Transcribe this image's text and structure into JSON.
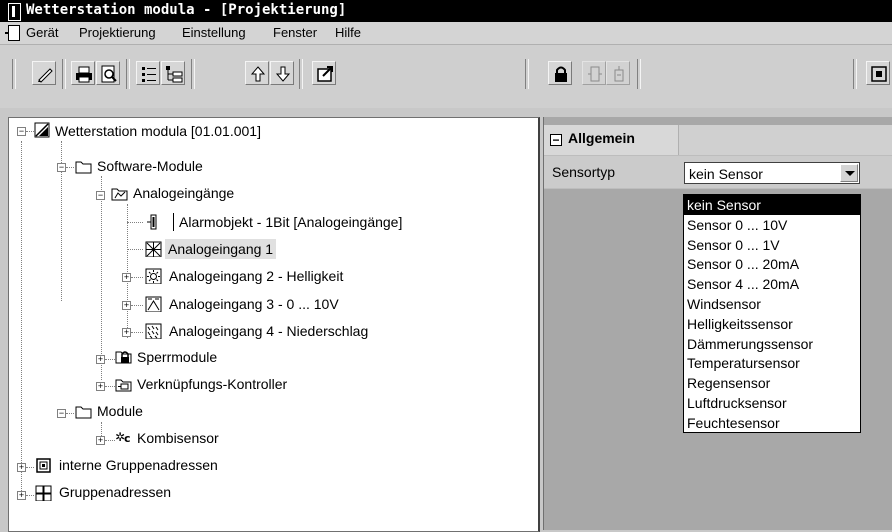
{
  "window": {
    "title": "Wetterstation modula  - [Projektierung]"
  },
  "menu": {
    "items": [
      "Gerät",
      "Projektierung",
      "Einstellung",
      "Fenster",
      "Hilfe"
    ]
  },
  "toolbar": {
    "buttons": [
      "edit-icon",
      "print-icon",
      "print-preview-icon",
      "list-icon",
      "tree-view-icon",
      "arrow-up-icon",
      "arrow-down-icon",
      "export-icon",
      "lock-icon",
      "module-icon",
      "module-add-icon",
      "group-address-icon"
    ]
  },
  "tree": {
    "root": "Wetterstation modula [01.01.001]",
    "software_modules": "Software-Module",
    "analog_inputs": "Analogeingänge",
    "alarm_object": "Alarmobjekt - 1Bit [Analogeingänge]",
    "analog_1": "Analogeingang 1",
    "analog_2": "Analogeingang 2 - Helligkeit",
    "analog_3": "Analogeingang 3 - 0 ... 10V",
    "analog_4": "Analogeingang 4 - Niederschlag",
    "lock_modules": "Sperrmodule",
    "logic_controller": "Verknüpfungs-Kontroller",
    "modules": "Module",
    "combi_sensor": "Kombisensor",
    "internal_groups": "interne Gruppenadressen",
    "groups": "Gruppenadressen"
  },
  "props": {
    "section": "Allgemein",
    "sensor_label": "Sensortyp",
    "sensor_value": "kein Sensor",
    "options": [
      "kein Sensor",
      "Sensor 0 ... 10V",
      "Sensor 0 ... 1V",
      "Sensor 0 ... 20mA",
      "Sensor 4 ... 20mA",
      "Windsensor",
      "Helligkeitssensor",
      "Dämmerungssensor",
      "Temperatursensor",
      "Regensensor",
      "Luftdrucksensor",
      "Feuchtesensor"
    ],
    "selected_option": "kein Sensor"
  }
}
